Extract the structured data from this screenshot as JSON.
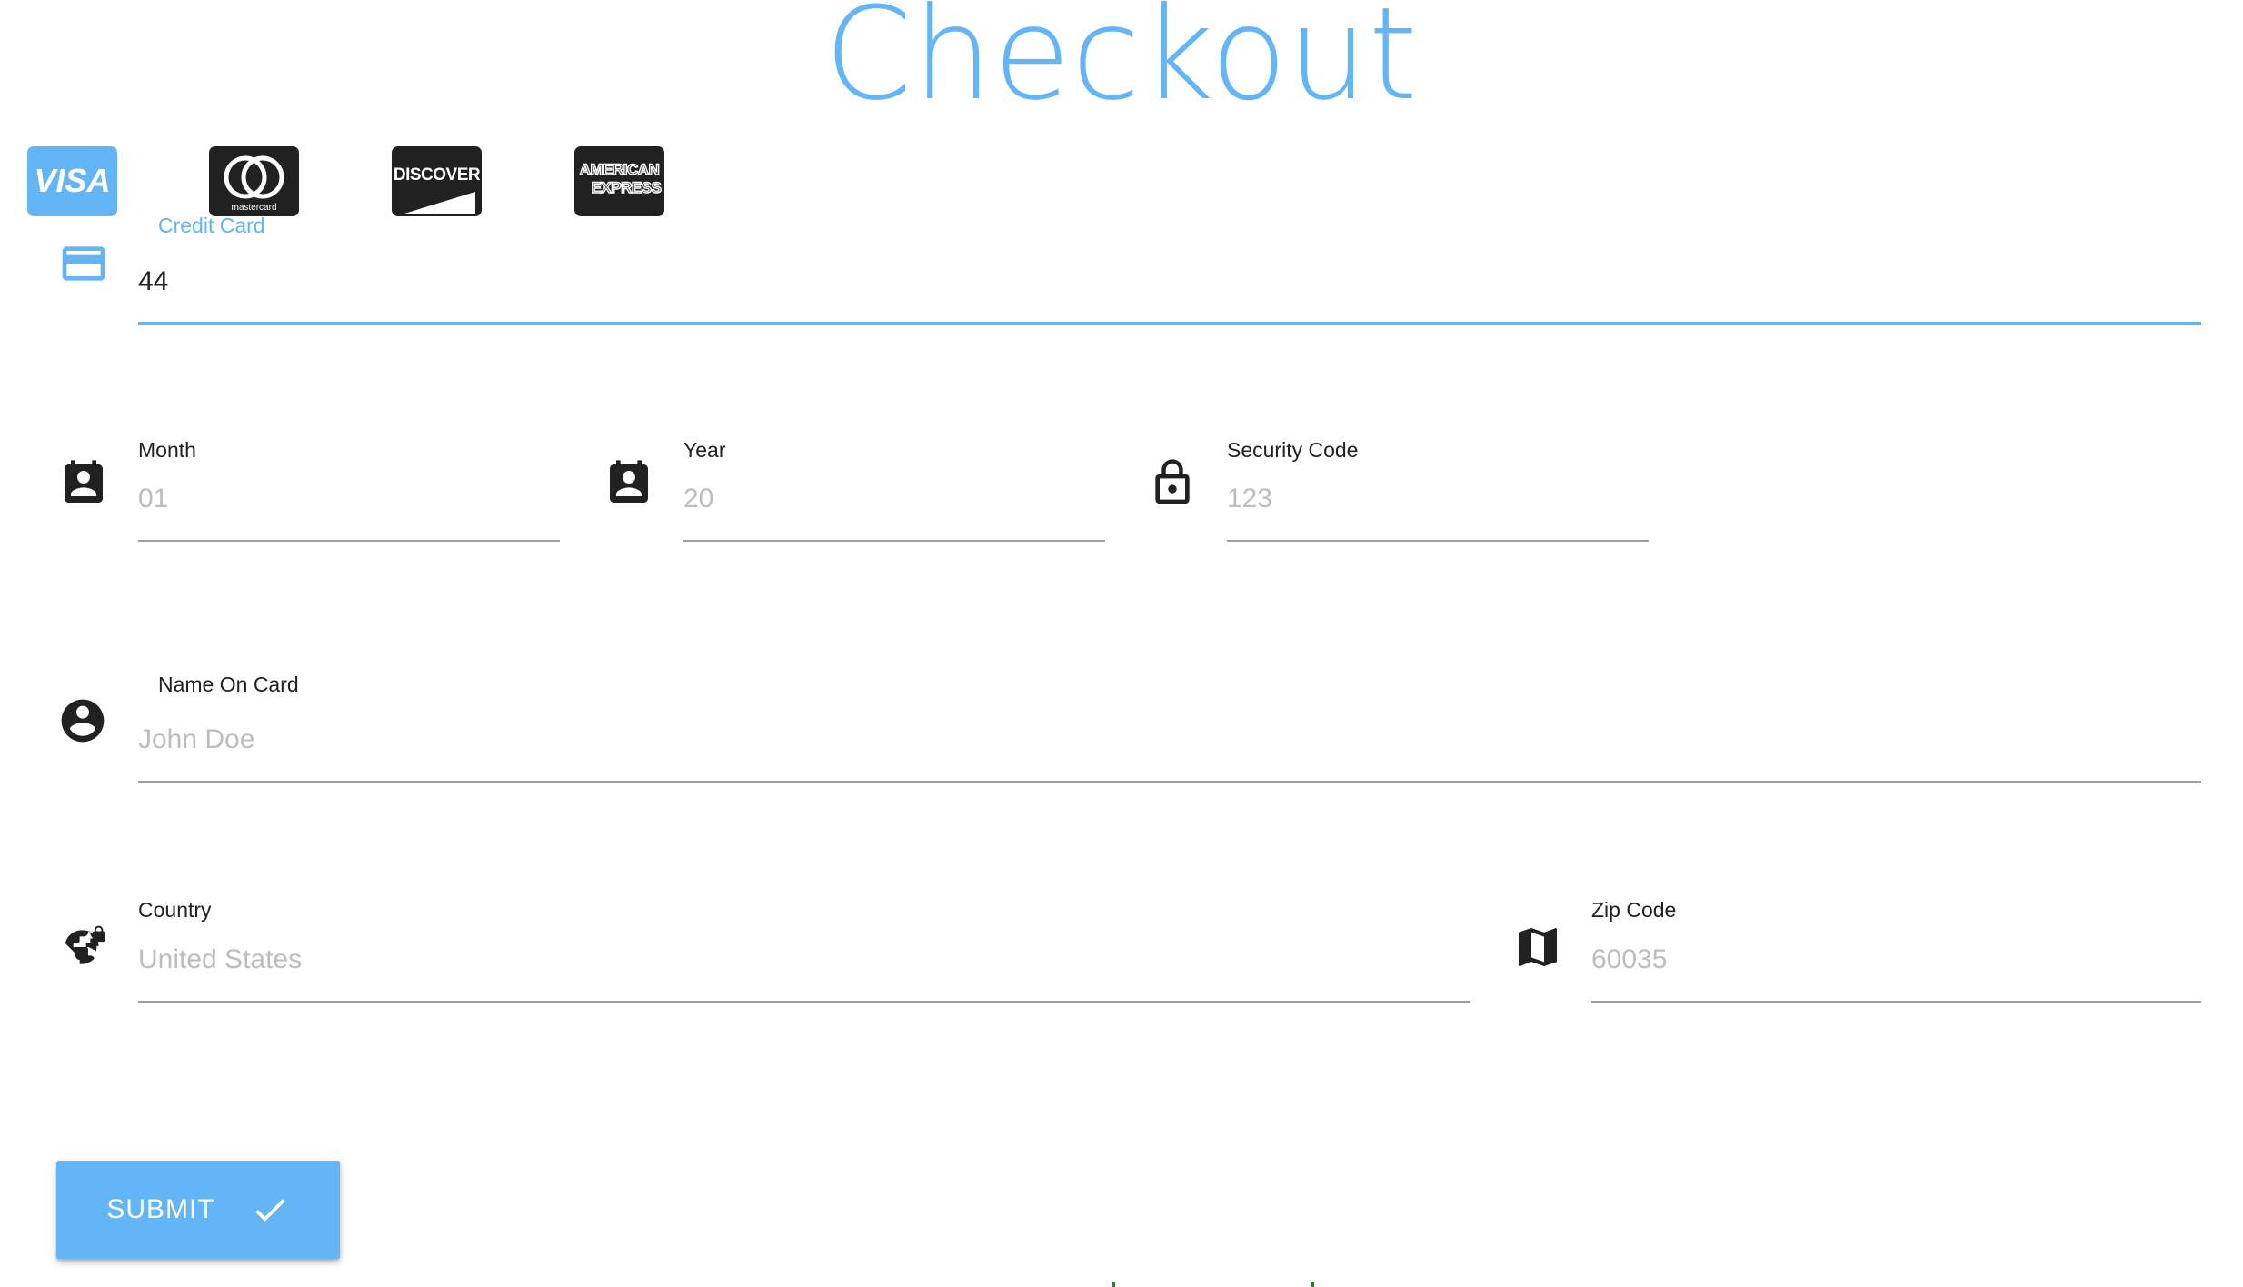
{
  "page": {
    "title": "Checkout"
  },
  "card_brands": [
    {
      "name": "VISA",
      "color": "#64b5f6"
    },
    {
      "name": "mastercard",
      "color": "#212121"
    },
    {
      "name": "DISCOVER",
      "color": "#212121"
    },
    {
      "name": "AMERICAN EXPRESS",
      "color": "#212121"
    }
  ],
  "credit_card": {
    "label": "Credit Card",
    "value": "44",
    "icon": "credit-card-icon"
  },
  "month": {
    "label": "Month",
    "placeholder": "01",
    "icon": "calendar-account-icon"
  },
  "year": {
    "label": "Year",
    "placeholder": "20",
    "icon": "calendar-account-icon"
  },
  "security_code": {
    "label": "Security Code",
    "placeholder": "123",
    "icon": "lock-icon"
  },
  "name_on_card": {
    "label": "Name On Card",
    "placeholder": "John Doe",
    "icon": "account-circle-icon"
  },
  "country": {
    "label": "Country",
    "placeholder": "United States",
    "icon": "globe-lock-icon"
  },
  "zip_code": {
    "label": "Zip Code",
    "placeholder": "60035",
    "icon": "map-icon"
  },
  "submit": {
    "label": "SUBMIT",
    "icon": "check-icon"
  },
  "colors": {
    "accent": "#64b5f6",
    "text": "#212121",
    "placeholder": "#bdbdbd",
    "divider": "#9e9e9e"
  }
}
